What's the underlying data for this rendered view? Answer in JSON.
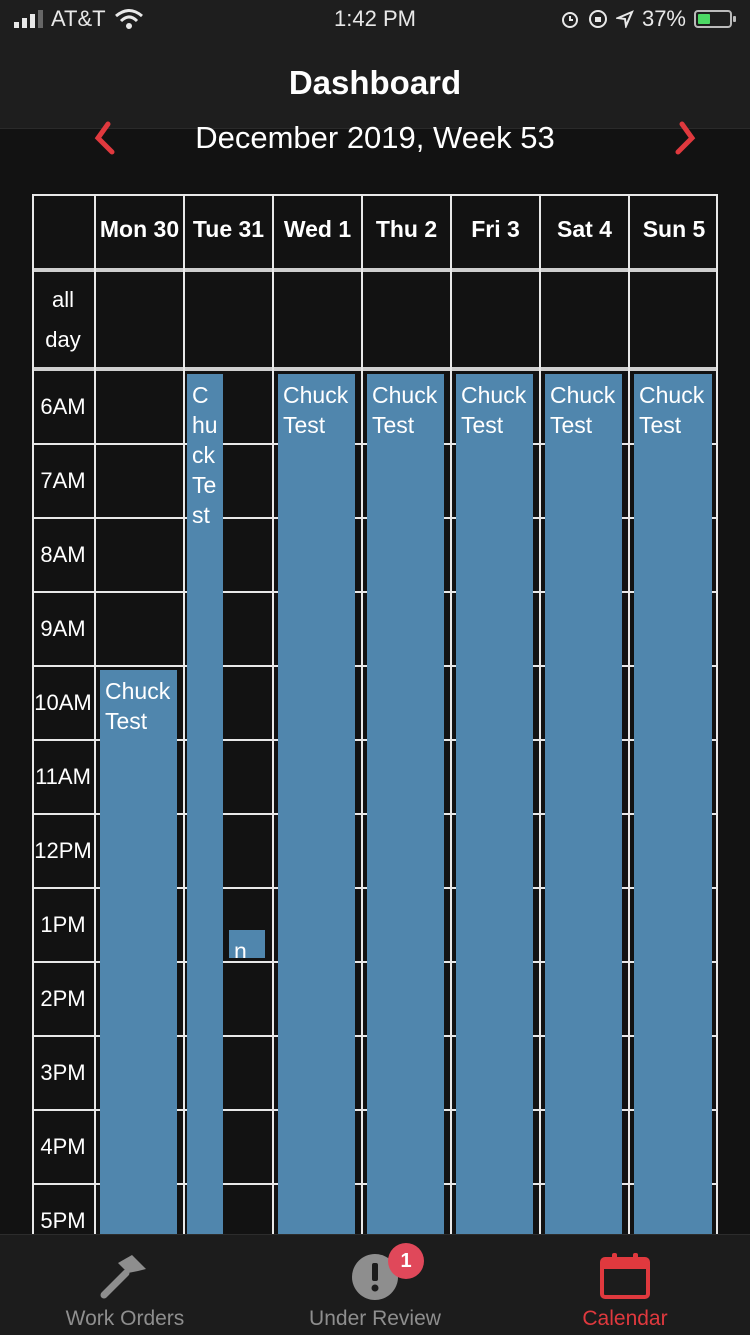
{
  "status_bar": {
    "carrier": "AT&T",
    "time": "1:42 PM",
    "battery": "37%",
    "icons": [
      "signal-icon",
      "wifi-icon",
      "alarm-icon",
      "rotation-lock-icon",
      "location-icon",
      "battery-icon"
    ]
  },
  "header": {
    "title": "Dashboard"
  },
  "calendar": {
    "week_title": "December 2019, Week 53",
    "prev_icon": "chevron-left-icon",
    "next_icon": "chevron-right-icon",
    "days": [
      "Mon 30",
      "Tue 31",
      "Wed 1",
      "Thu 2",
      "Fri 3",
      "Sat 4",
      "Sun 5"
    ],
    "all_day_label": "all day",
    "hours": [
      "6AM",
      "7AM",
      "8AM",
      "9AM",
      "10AM",
      "11AM",
      "12PM",
      "1PM",
      "2PM",
      "3PM",
      "4PM",
      "5PM"
    ],
    "events": [
      {
        "day": "Mon 30",
        "title": "Chuck Test",
        "start": "10AM",
        "extends_past_view": true
      },
      {
        "day": "Tue 31",
        "title": "Chuck Test",
        "start": "6AM",
        "extends_past_view": true
      },
      {
        "day": "Tue 31",
        "title": "n",
        "start": "1PM"
      },
      {
        "day": "Wed 1",
        "title": "Chuck Test",
        "start": "6AM",
        "extends_past_view": true
      },
      {
        "day": "Thu 2",
        "title": "Chuck Test",
        "start": "6AM",
        "extends_past_view": true
      },
      {
        "day": "Fri 3",
        "title": "Chuck Test",
        "start": "6AM",
        "extends_past_view": true
      },
      {
        "day": "Sat 4",
        "title": "Chuck Test",
        "start": "6AM",
        "extends_past_view": true
      },
      {
        "day": "Sun 5",
        "title": "Chuck Test",
        "start": "6AM",
        "extends_past_view": true
      }
    ],
    "event_color": "#5086ad"
  },
  "tab_bar": {
    "tabs": [
      {
        "label": "Work Orders",
        "icon": "hammer-icon",
        "active": false
      },
      {
        "label": "Under Review",
        "icon": "alert-icon",
        "active": false,
        "badge": "1"
      },
      {
        "label": "Calendar",
        "icon": "calendar-icon",
        "active": true
      }
    ],
    "active_color": "#e0393e"
  }
}
